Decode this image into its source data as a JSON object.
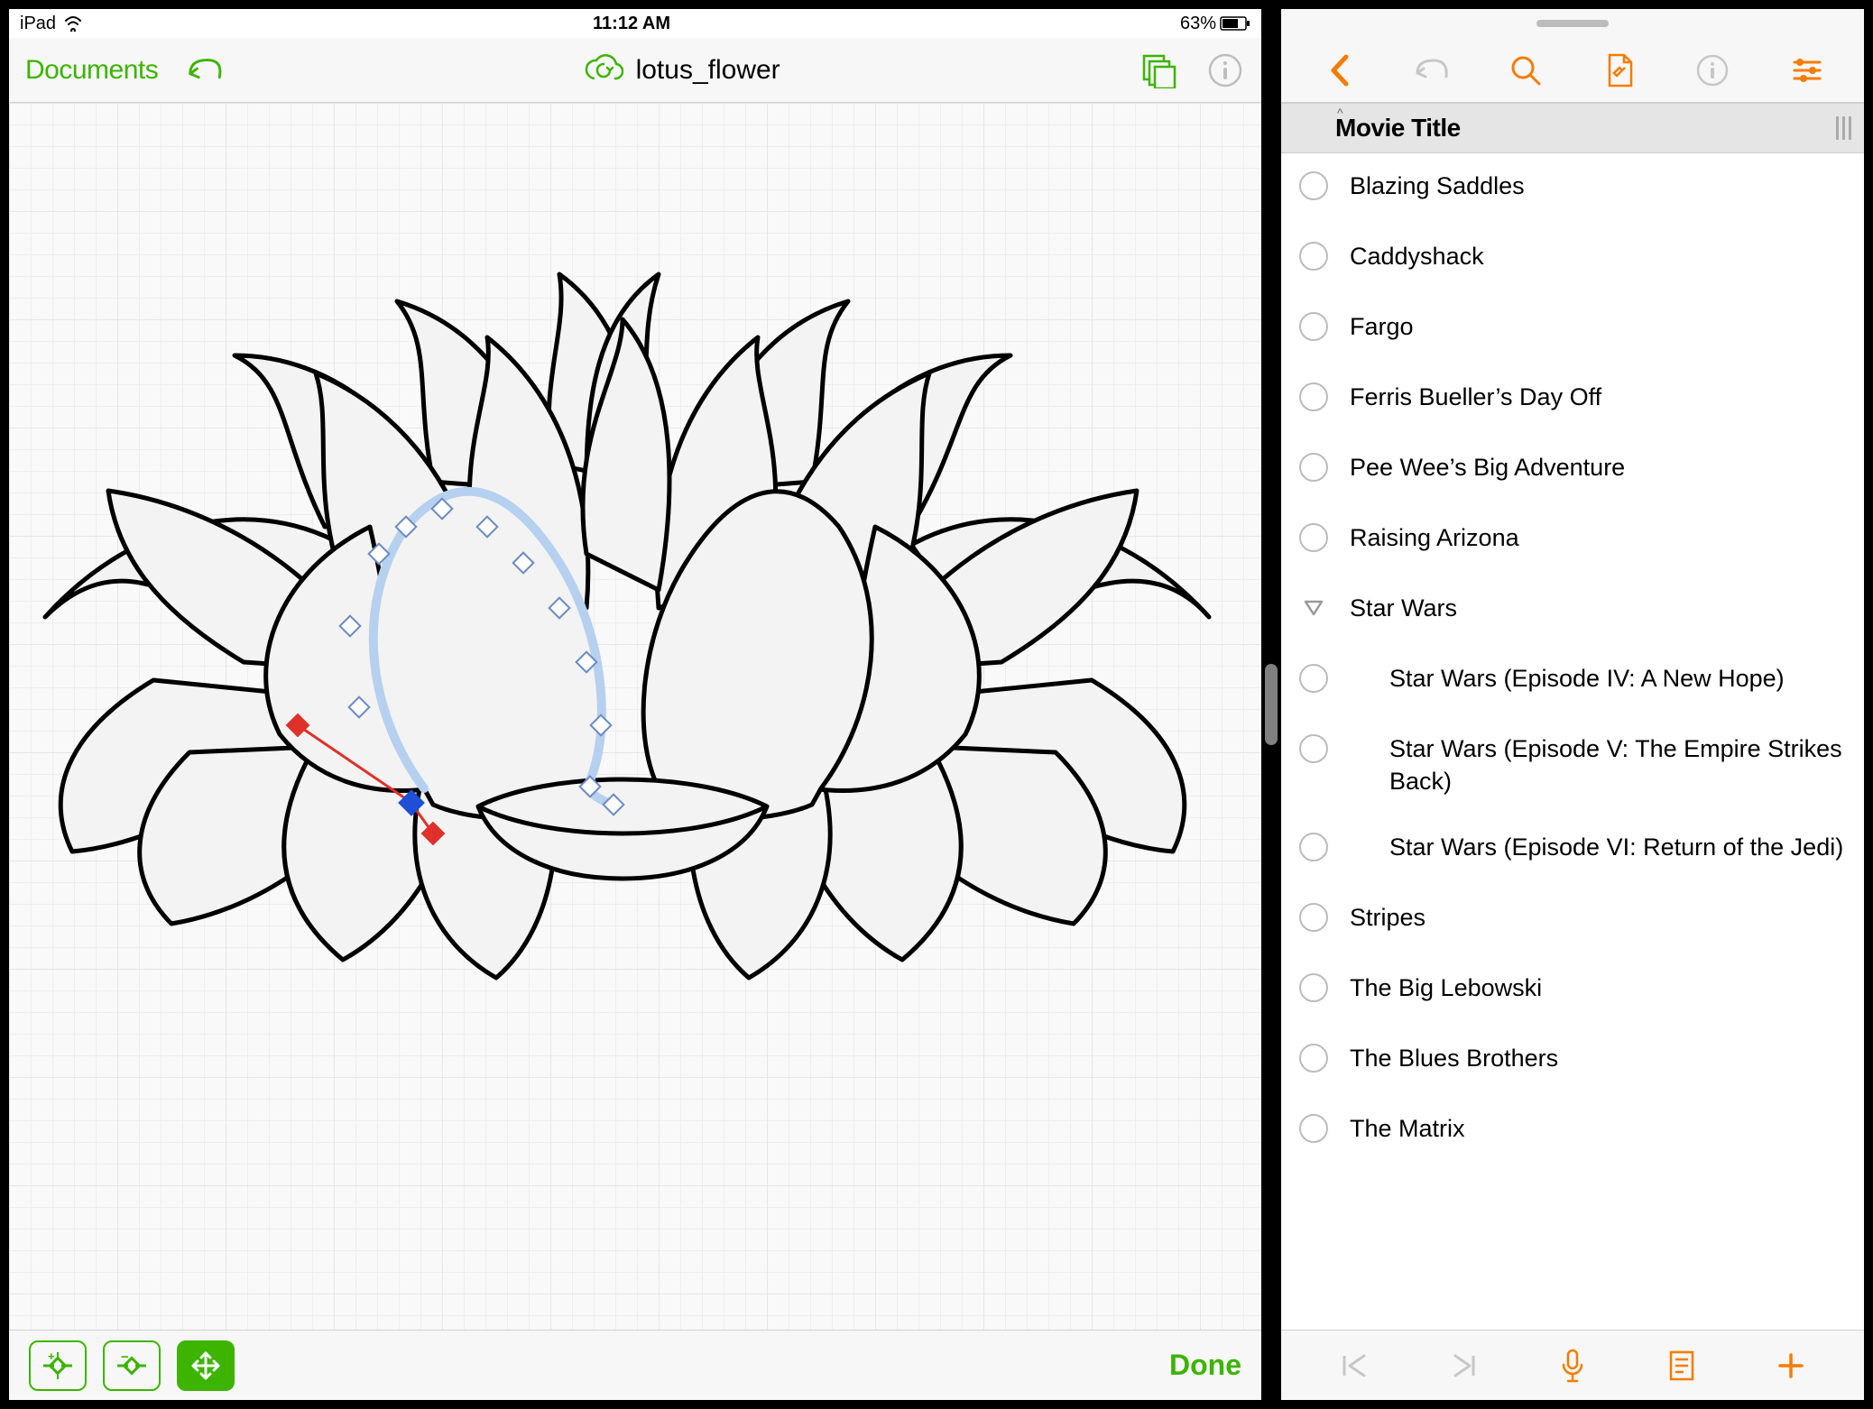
{
  "status": {
    "device": "iPad",
    "time": "11:12 AM",
    "battery_pct": "63%"
  },
  "left": {
    "documents_label": "Documents",
    "title": "lotus_flower",
    "done_label": "Done"
  },
  "right": {
    "header": "Movie Title",
    "items": [
      {
        "label": "Blazing Saddles",
        "kind": "item"
      },
      {
        "label": "Caddyshack",
        "kind": "item"
      },
      {
        "label": "Fargo",
        "kind": "item"
      },
      {
        "label": "Ferris Bueller’s Day Off",
        "kind": "item"
      },
      {
        "label": "Pee Wee’s Big Adventure",
        "kind": "item"
      },
      {
        "label": "Raising Arizona",
        "kind": "item"
      },
      {
        "label": "Star Wars",
        "kind": "group"
      },
      {
        "label": "Star Wars (Episode IV: A New Hope)",
        "kind": "child"
      },
      {
        "label": "Star Wars (Episode V: The Empire Strikes Back)",
        "kind": "child"
      },
      {
        "label": "Star Wars (Episode VI: Return of the Jedi)",
        "kind": "child"
      },
      {
        "label": "Stripes",
        "kind": "item"
      },
      {
        "label": "The Big Lebowski",
        "kind": "item"
      },
      {
        "label": "The Blues Brothers",
        "kind": "item"
      },
      {
        "label": "The Matrix",
        "kind": "item"
      }
    ]
  }
}
